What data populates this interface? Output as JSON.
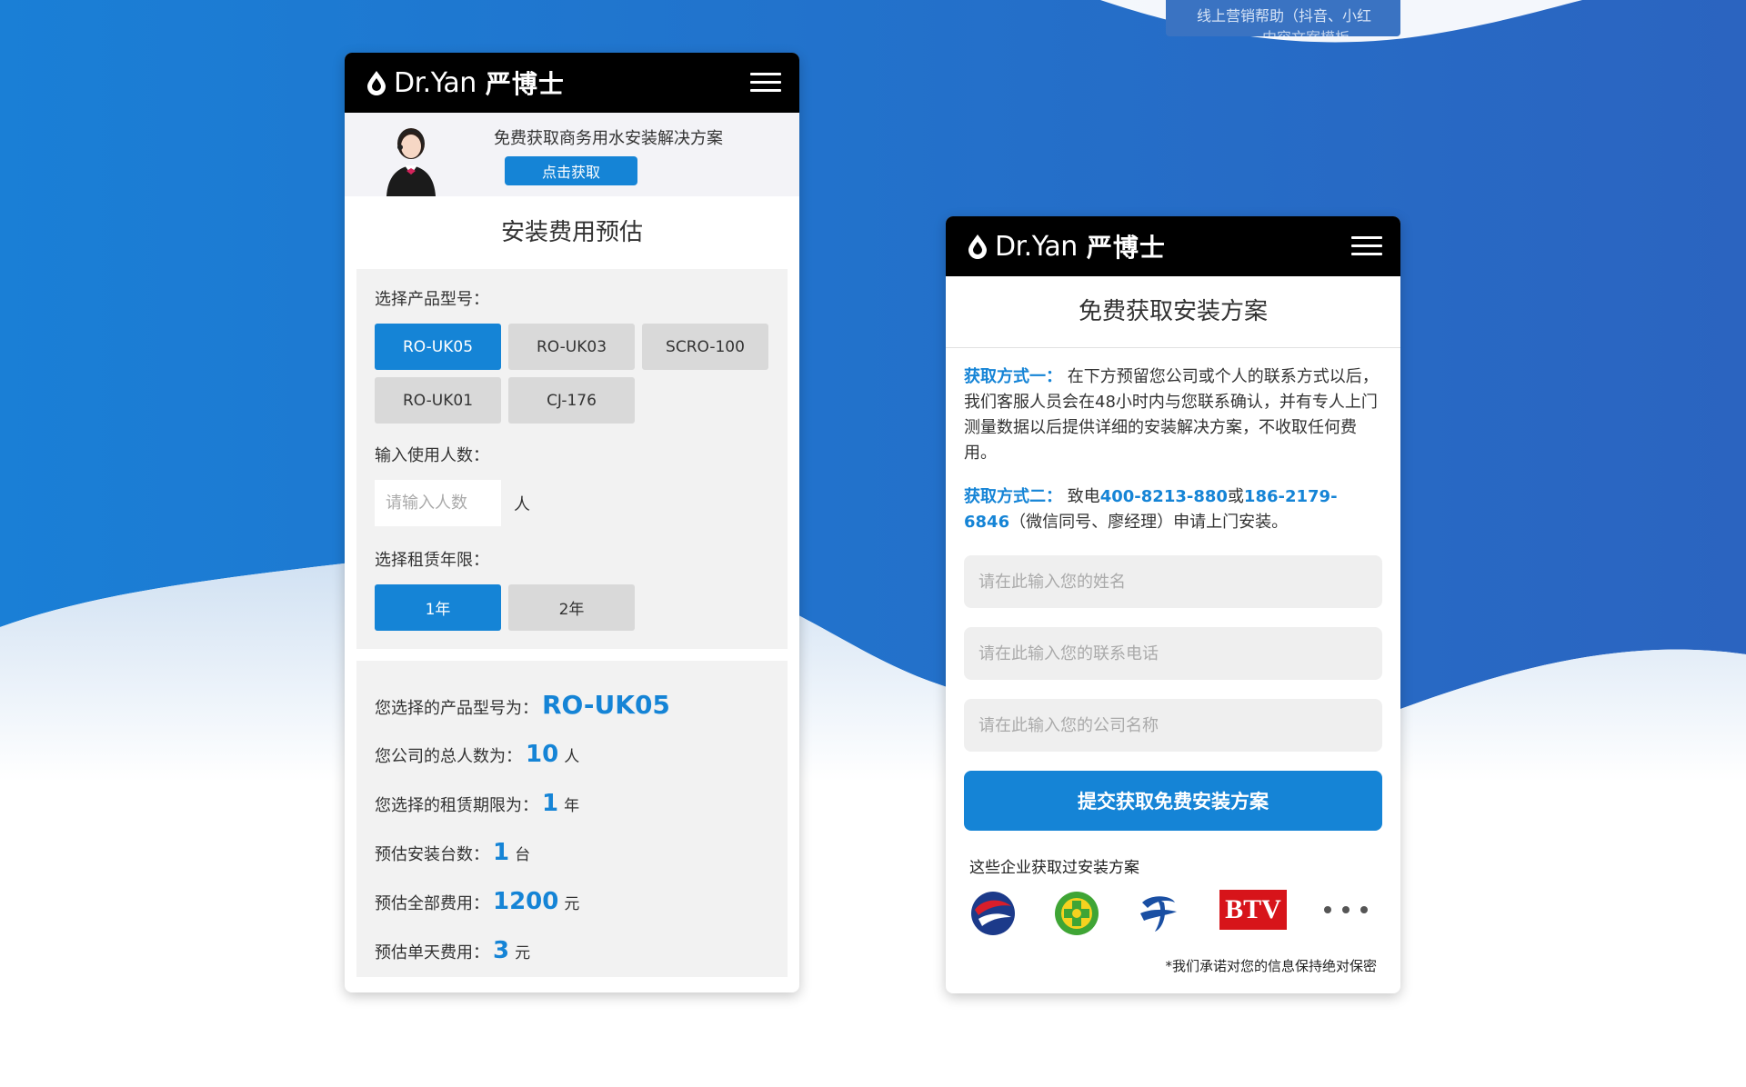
{
  "background": {
    "note_line1": "线上营销帮助（抖音、小红",
    "note_line2": "……、内容文案模板"
  },
  "brand": {
    "logo_text": "Dr.Yan",
    "logo_cn": "严博士"
  },
  "estimator": {
    "banner_text": "免费获取商务用水安装解决方案",
    "banner_button": "点击获取",
    "title": "安装费用预估",
    "product_label": "选择产品型号：",
    "products": [
      "RO-UK05",
      "RO-UK03",
      "SCRO-100",
      "RO-UK01",
      "CJ-176"
    ],
    "selected_product": "RO-UK05",
    "people_label": "输入使用人数：",
    "people_placeholder": "请输入人数",
    "people_unit": "人",
    "lease_label": "选择租赁年限：",
    "lease_options": [
      "1年",
      "2年"
    ],
    "selected_lease": "1年",
    "results": {
      "model_label": "您选择的产品型号为：",
      "model_value": "RO-UK05",
      "people_label": "您公司的总人数为：",
      "people_value": "10",
      "people_unit": "人",
      "lease_label": "您选择的租赁期限为：",
      "lease_value": "1",
      "lease_unit": "年",
      "units_label": "预估安装台数：",
      "units_value": "1",
      "units_unit": "台",
      "total_label": "预估全部费用：",
      "total_value": "1200",
      "total_unit": "元",
      "daily_label": "预估单天费用：",
      "daily_value": "3",
      "daily_unit": "元"
    }
  },
  "contact": {
    "title": "免费获取安装方案",
    "method1_label": "获取方式一：",
    "method1_text": "在下方预留您公司或个人的联系方式以后，我们客服人员会在48小时内与您联系确认，并有专人上门测量数据以后提供详细的安装解决方案，不收取任何费用。",
    "method2_label": "获取方式二：",
    "method2_prefix": "致电",
    "phone1": "400-8213-880",
    "method2_or": "或",
    "phone2": "186-2179-6846",
    "method2_suffix": "（微信同号、廖经理）申请上门安装。",
    "name_placeholder": "请在此输入您的姓名",
    "phone_placeholder": "请在此输入您的联系电话",
    "company_placeholder": "请在此输入您的公司名称",
    "submit_label": "提交获取免费安装方案",
    "clients_title": "这些企业获取过安装方案",
    "client_logos": [
      "china-eastern-logo-icon",
      "360-logo-icon",
      "china-telecom-logo-icon",
      "btv-logo-icon",
      "more-dots-icon"
    ],
    "btv_text": "BTV",
    "privacy": "*我们承诺对您的信息保持绝对保密"
  },
  "colors": {
    "accent": "#1584d6",
    "bg_blue": "#1a78d2",
    "header": "#000000"
  }
}
